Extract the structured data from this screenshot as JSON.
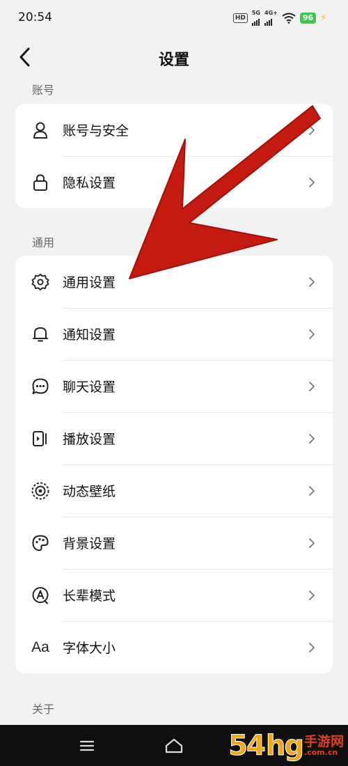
{
  "status_bar": {
    "time": "20:54",
    "hd_badge": "HD",
    "network_1": "5G",
    "network_2": "4G+",
    "battery": "96",
    "battery_color": "#3cc84a"
  },
  "navbar": {
    "back_icon": "chevron-left-icon",
    "title": "设置"
  },
  "sections": {
    "account": {
      "label": "账号",
      "items": [
        {
          "label": "账号与安全",
          "icon": "person-icon"
        },
        {
          "label": "隐私设置",
          "icon": "lock-icon"
        }
      ]
    },
    "general": {
      "label": "通用",
      "items": [
        {
          "label": "通用设置",
          "icon": "gear-icon"
        },
        {
          "label": "通知设置",
          "icon": "bell-icon"
        },
        {
          "label": "聊天设置",
          "icon": "chat-bubble-icon"
        },
        {
          "label": "播放设置",
          "icon": "play-screen-icon"
        },
        {
          "label": "动态壁纸",
          "icon": "live-wallpaper-icon"
        },
        {
          "label": "背景设置",
          "icon": "palette-icon"
        },
        {
          "label": "长辈模式",
          "icon": "elder-mode-icon"
        },
        {
          "label": "字体大小",
          "icon": "font-size-icon",
          "icon_text": "Aa"
        }
      ]
    },
    "about": {
      "label": "关于"
    }
  },
  "bottom_nav": {
    "menu_icon": "menu-icon",
    "home_icon": "home-icon"
  },
  "annotation": {
    "arrow_color": "#c41a12",
    "arrow_target": "通用设置"
  },
  "watermark": {
    "number": "54",
    "glyph": "hg",
    "cn": "手游网",
    "url": ".com.cn"
  }
}
